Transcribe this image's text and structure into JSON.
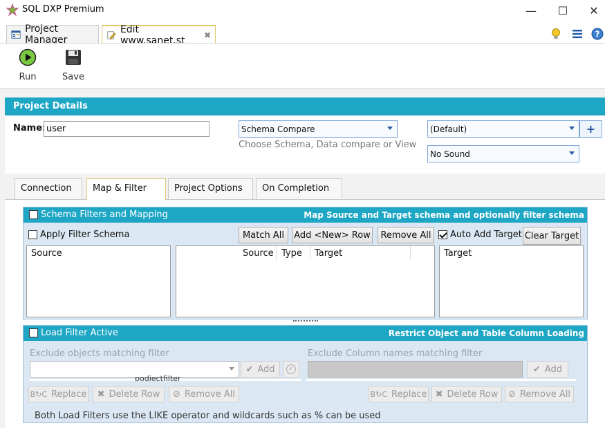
{
  "window": {
    "title": "SQL DXP Premium",
    "minimize": "—",
    "maximize": "☐",
    "close": "✕"
  },
  "tabs": [
    {
      "label": "Project Manager"
    },
    {
      "label": "Edit www.sanet.st",
      "close": "✖"
    }
  ],
  "toolbar": {
    "run_label": "Run",
    "save_label": "Save"
  },
  "project_details": {
    "header": "Project Details",
    "name_label": "Name:",
    "name_value": "user",
    "compare_type": "Schema Compare",
    "compare_hint": "Choose Schema, Data compare or View",
    "profile": "(Default)",
    "add_symbol": "+",
    "sound": "No Sound"
  },
  "inner_tabs": [
    {
      "label": "Connection"
    },
    {
      "label": "Map & Filter"
    },
    {
      "label": "Project Options"
    },
    {
      "label": "On Completion"
    }
  ],
  "schema_filters": {
    "title": "Schema Filters and Mapping",
    "subtitle": "Map Source and Target schema and optionally filter schema",
    "apply_filter_label": "Apply Filter Schema",
    "match_all": "Match All",
    "add_new_row": "Add <New> Row",
    "remove_all": "Remove All",
    "auto_add_target_label": "Auto Add Target",
    "auto_add_target_checked": true,
    "clear_target": "Clear Target",
    "source_list_header": "Source",
    "mapping_columns": [
      "Source",
      "Type",
      "Target"
    ],
    "target_list_header": "Target"
  },
  "load_filter": {
    "title": "Load Filter Active",
    "subtitle": "Restrict Object and Table Column Loading",
    "exclude_objects_label": "Exclude objects matching filter",
    "exclude_columns_label": "Exclude Column names matching filter",
    "add_label": "Add",
    "replace_label": "Replace",
    "delete_row_label": "Delete Row",
    "remove_all_label": "Remove All",
    "clipped_text": "podjectfilter",
    "footer_note": "Both Load Filters use the LIKE operator and wildcards such as % can be used"
  },
  "colors": {
    "accent": "#1ea6c5",
    "panel_bg": "#dbe8f3",
    "tab_highlight": "#e0c66d"
  }
}
